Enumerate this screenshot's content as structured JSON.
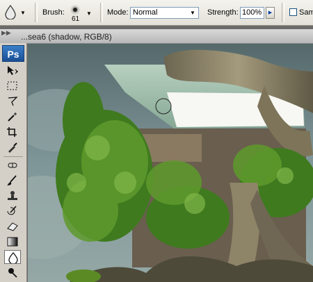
{
  "options_bar": {
    "tool_icon": "water-drop-icon",
    "brush_label": "Brush:",
    "brush_size": "61",
    "mode_label": "Mode:",
    "mode_value": "Normal",
    "strength_label": "Strength:",
    "strength_value": "100%",
    "sample_label": "Samp"
  },
  "document": {
    "title": "...sea6 (shadow, RGB/8)"
  },
  "toolbox": {
    "logo": "Ps",
    "tools": [
      "move-icon",
      "marquee-icon",
      "lasso-icon",
      "magic-wand-icon",
      "crop-icon",
      "eyedropper-icon",
      "healing-brush-icon",
      "brush-icon",
      "clone-stamp-icon",
      "history-brush-icon",
      "eraser-icon",
      "gradient-icon",
      "blur-icon",
      "dodge-icon"
    ],
    "active_tool": "blur-icon"
  },
  "colors": {
    "sky": "#6f8a8c",
    "foliage": "#4f8a26",
    "roof": "#9bb9a4",
    "trunk": "#8a8066"
  }
}
